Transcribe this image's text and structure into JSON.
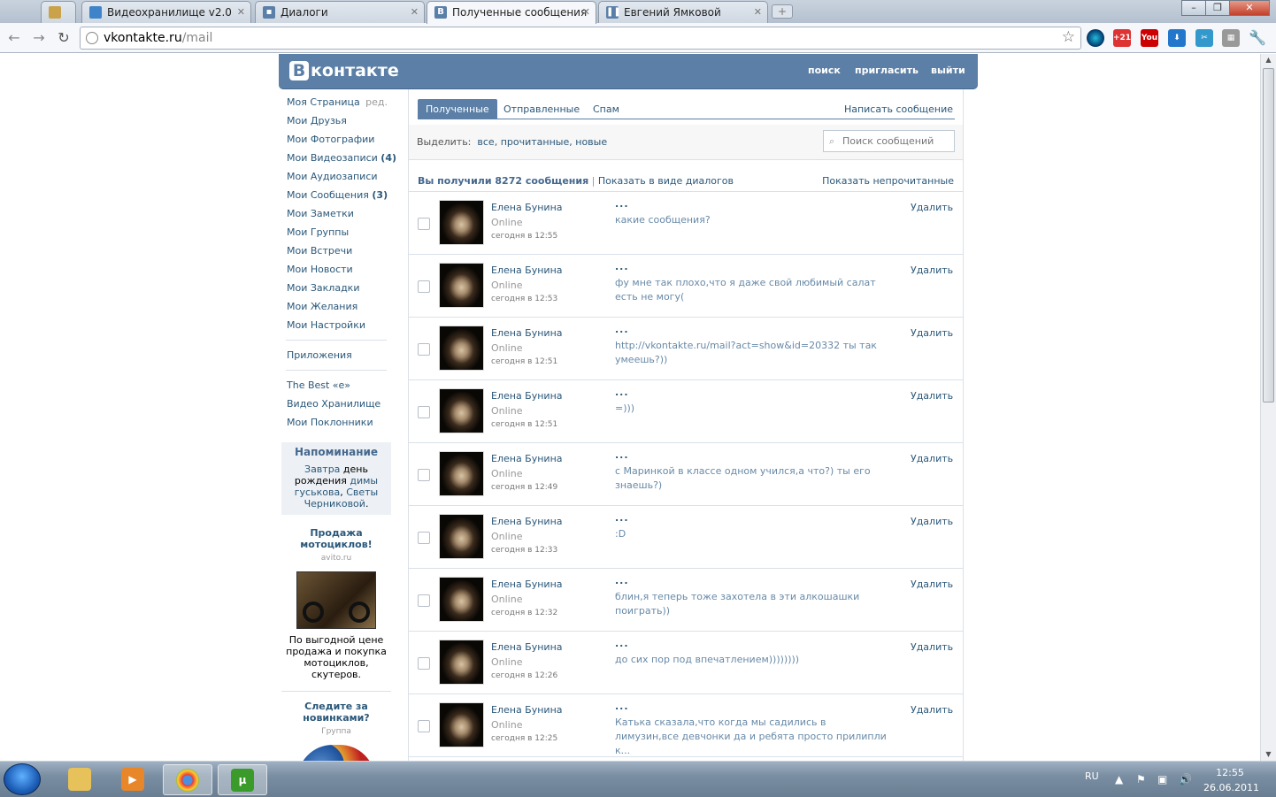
{
  "browser": {
    "tabs": [
      {
        "label": "",
        "icon": "file-manager-icon"
      },
      {
        "label": "Видеохранилище v2.0",
        "icon": "video-icon"
      },
      {
        "label": "Диалоги",
        "icon": "chat-icon"
      },
      {
        "label": "Полученные сообщения",
        "icon": "vk-icon"
      },
      {
        "label": "Евгений Ямковой",
        "icon": "pause-icon"
      }
    ],
    "url_host": "vkontakte.ru",
    "url_path": "/mail"
  },
  "vk": {
    "logo": "контакте",
    "top_links": {
      "search": "поиск",
      "invite": "пригласить",
      "logout": "выйти"
    }
  },
  "leftnav": {
    "items": [
      {
        "label": "Моя Страница",
        "extra": "ред."
      },
      {
        "label": "Мои Друзья"
      },
      {
        "label": "Мои Фотографии"
      },
      {
        "label": "Мои Видеозаписи",
        "count": "(4)"
      },
      {
        "label": "Мои Аудиозаписи"
      },
      {
        "label": "Мои Сообщения",
        "count": "(3)"
      },
      {
        "label": "Мои Заметки"
      },
      {
        "label": "Мои Группы"
      },
      {
        "label": "Мои Встречи"
      },
      {
        "label": "Мои Новости"
      },
      {
        "label": "Мои Закладки"
      },
      {
        "label": "Мои Желания"
      },
      {
        "label": "Мои Настройки"
      }
    ],
    "apps": "Приложения",
    "extra_items": [
      "The Best «e»",
      "Видео Хранилище",
      "Мои Поклонники"
    ],
    "reminder": {
      "title": "Напоминание",
      "w1": "Завтра",
      "w2": " день рождения ",
      "w3": "димы гуськова",
      "w4": ", ",
      "w5": "Светы Черниковой",
      "w6": "."
    },
    "ad": {
      "title": "Продажа мотоциклов!",
      "domain": "avito.ru",
      "text": "По выгодной цене продажа и покупка мотоциклов, скутеров."
    },
    "ad2": {
      "title": "Следите за новинками?",
      "domain": "Группа"
    }
  },
  "mail": {
    "tabs": {
      "inbox": "Полученные",
      "sent": "Отправленные",
      "spam": "Спам"
    },
    "write": "Написать сообщение",
    "select_label": "Выделить:",
    "select_all": "все",
    "select_read": "прочитанные",
    "select_new": "новые",
    "search_placeholder": "Поиск сообщений",
    "summary": "Вы получили 8272 сообщения",
    "as_dialogs": "Показать в виде диалогов",
    "show_unread": "Показать непрочитанные",
    "delete_label": "Удалить",
    "messages": [
      {
        "name": "Елена Бунина",
        "status": "Online",
        "time": "сегодня в 12:55",
        "dots": "...",
        "text": "какие сообщения?"
      },
      {
        "name": "Елена Бунина",
        "status": "Online",
        "time": "сегодня в 12:53",
        "dots": "...",
        "text": "фу мне так плохо,что я даже свой любимый салат есть не могу("
      },
      {
        "name": "Елена Бунина",
        "status": "Online",
        "time": "сегодня в 12:51",
        "dots": "...",
        "text": "http://vkontakte.ru/mail?act=show&id=20332 ты так умеешь?))"
      },
      {
        "name": "Елена Бунина",
        "status": "Online",
        "time": "сегодня в 12:51",
        "dots": "...",
        "text": "=)))"
      },
      {
        "name": "Елена Бунина",
        "status": "Online",
        "time": "сегодня в 12:49",
        "dots": "...",
        "text": "с Маринкой в классе одном учился,а что?) ты его знаешь?)"
      },
      {
        "name": "Елена Бунина",
        "status": "Online",
        "time": "сегодня в 12:33",
        "dots": "...",
        "text": ":D"
      },
      {
        "name": "Елена Бунина",
        "status": "Online",
        "time": "сегодня в 12:32",
        "dots": "...",
        "text": "блин,я теперь тоже захотела в эти алкошашки поиграть))"
      },
      {
        "name": "Елена Бунина",
        "status": "Online",
        "time": "сегодня в 12:26",
        "dots": "...",
        "text": "до сих пор под впечатлением))))))))"
      },
      {
        "name": "Елена Бунина",
        "status": "Online",
        "time": "сегодня в 12:25",
        "dots": "...",
        "text": "Катька сказала,что когда мы садились в лимузин,все девчонки да и ребята просто прилипли к..."
      }
    ]
  },
  "taskbar": {
    "lang": "RU",
    "time": "12:55",
    "date": "26.06.2011"
  },
  "colors": {
    "vk_blue": "#5b7fa6",
    "link": "#2b587a",
    "muted_link": "#688aa8"
  }
}
